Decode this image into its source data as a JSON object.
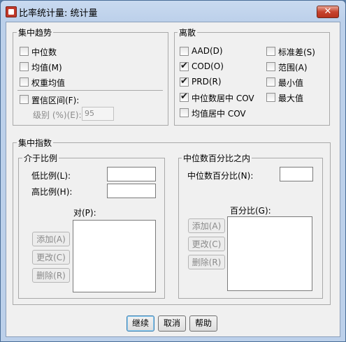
{
  "window": {
    "title": "比率统计量: 统计量",
    "close_glyph": "✕"
  },
  "central_tendency": {
    "legend": "集中趋势",
    "median": {
      "label": "中位数",
      "checked": false
    },
    "mean": {
      "label": "均值(M)",
      "checked": false
    },
    "weighted_mean": {
      "label": "权重均值",
      "checked": false
    },
    "confidence_intervals": {
      "label": "置信区间(F):",
      "checked": false
    },
    "level_label": "级别 (%)(E):",
    "level_value": "95"
  },
  "dispersion": {
    "legend": "离散",
    "aad": {
      "label": "AAD(D)",
      "checked": false
    },
    "cod": {
      "label": "COD(O)",
      "checked": true
    },
    "prd": {
      "label": "PRD(R)",
      "checked": true
    },
    "median_cov": {
      "label": "中位数居中 COV",
      "checked": true
    },
    "mean_cov": {
      "label": "均值居中 COV",
      "checked": false
    },
    "std_dev": {
      "label": "标准差(S)",
      "checked": false
    },
    "range": {
      "label": "范围(A)",
      "checked": false
    },
    "minimum": {
      "label": "最小值",
      "checked": false
    },
    "maximum": {
      "label": "最大值",
      "checked": false
    }
  },
  "concentration": {
    "legend": "集中指数",
    "between": {
      "legend": "介于比例",
      "low_label": "低比例(L):",
      "high_label": "高比例(H):",
      "pairs_label": "对(P):",
      "add": "添加(A)",
      "change": "更改(C)",
      "remove": "删除(R)"
    },
    "within": {
      "legend": "中位数百分比之内",
      "percent_of_median_label": "中位数百分比(N):",
      "percentages_label": "百分比(G):",
      "add": "添加(A)",
      "change": "更改(C)",
      "remove": "删除(R)"
    }
  },
  "footer": {
    "continue": "继续",
    "cancel": "取消",
    "help": "帮助"
  }
}
